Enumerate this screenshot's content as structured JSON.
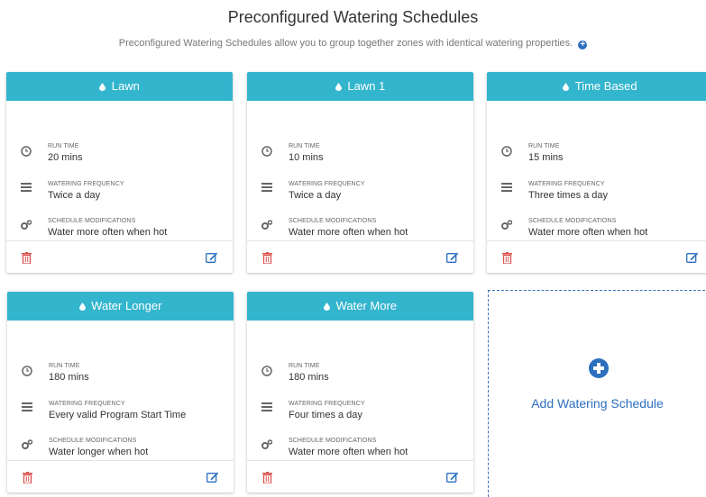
{
  "page": {
    "title": "Preconfigured Watering Schedules",
    "subtitle": "Preconfigured Watering Schedules allow you to group together zones with identical watering properties."
  },
  "labels": {
    "run_time": "RUN TIME",
    "frequency": "WATERING FREQUENCY",
    "modifications": "SCHEDULE MODIFICATIONS"
  },
  "cards": [
    {
      "name": "Lawn",
      "run_time": "20 mins",
      "frequency": "Twice a day",
      "modifications": "Water more often when hot"
    },
    {
      "name": "Lawn 1",
      "run_time": "10 mins",
      "frequency": "Twice a day",
      "modifications": "Water more often when hot"
    },
    {
      "name": "Time Based",
      "run_time": "15 mins",
      "frequency": "Three times a day",
      "modifications": "Water more often when hot"
    },
    {
      "name": "Water Longer",
      "run_time": "180 mins",
      "frequency": "Every valid Program Start Time",
      "modifications": "Water longer when hot"
    },
    {
      "name": "Water More",
      "run_time": "180 mins",
      "frequency": "Four times a day",
      "modifications": "Water more often when hot"
    }
  ],
  "add_schedule": {
    "label": "Add Watering Schedule"
  },
  "icons": {
    "header": "water-drop-icon",
    "run_time": "clock-icon",
    "frequency": "list-icon",
    "modifications": "gears-icon",
    "delete": "trash-icon",
    "edit": "edit-icon",
    "add": "plus-circle-icon",
    "info": "info-plus-icon"
  },
  "colors": {
    "header": "#33b5ce",
    "accent": "#2c6fbf",
    "delete": "#d9534f"
  }
}
